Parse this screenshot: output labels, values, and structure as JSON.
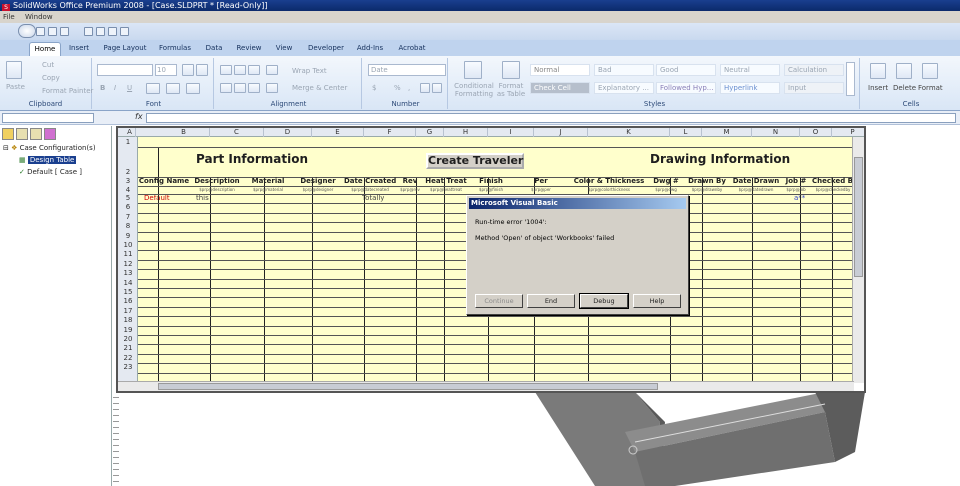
{
  "window": {
    "title": "SolidWorks Office Premium 2008 - [Case.SLDPRT * [Read-Only]]",
    "logo": "S"
  },
  "menu": [
    "File",
    "Window"
  ],
  "ribbon": {
    "tabs": [
      "Home",
      "Insert",
      "Page Layout",
      "Formulas",
      "Data",
      "Review",
      "View",
      "Developer",
      "Add-Ins",
      "Acrobat"
    ],
    "clipboard": {
      "paste": "Paste",
      "cut": "Cut",
      "copy": "Copy",
      "format_painter": "Format Painter",
      "label": "Clipboard"
    },
    "font": {
      "size": "10",
      "bold": "B",
      "italic": "I",
      "underline": "U",
      "label": "Font"
    },
    "alignment": {
      "wrap": "Wrap Text",
      "merge": "Merge & Center",
      "label": "Alignment"
    },
    "number": {
      "format": "Date",
      "currency": "$",
      "percent": "%",
      "comma": ",",
      "label": "Number"
    },
    "styles": {
      "conditional": "Conditional Formatting",
      "format_table": "Format as Table",
      "label": "Styles",
      "items": [
        {
          "name": "Normal",
          "bg": "#ffffff",
          "fg": "#888888"
        },
        {
          "name": "Bad",
          "bg": "#f7fbff",
          "fg": "#9aa5b3"
        },
        {
          "name": "Good",
          "bg": "#f7fbff",
          "fg": "#9aa5b3"
        },
        {
          "name": "Neutral",
          "bg": "#f7fbff",
          "fg": "#9aa5b3"
        },
        {
          "name": "Calculation",
          "bg": "#eef2f7",
          "fg": "#9aa5b3"
        },
        {
          "name": "Check Cell",
          "bg": "#b6bfcc",
          "fg": "#ffffff"
        },
        {
          "name": "Explanatory ...",
          "bg": "#f7fbff",
          "fg": "#9aa5b3"
        },
        {
          "name": "Followed Hyp...",
          "bg": "#f7fbff",
          "fg": "#8a7fb8"
        },
        {
          "name": "Hyperlink",
          "bg": "#f7fbff",
          "fg": "#6a8fd0"
        },
        {
          "name": "Input",
          "bg": "#eef2f7",
          "fg": "#9aa5b3"
        }
      ]
    },
    "cells": {
      "insert": "Insert",
      "delete": "Delete",
      "format": "Format",
      "label": "Cells"
    }
  },
  "formula_bar": {
    "fx": "fx"
  },
  "feature_tree": {
    "root": "Case Configuration(s)",
    "items": [
      "Design Table",
      "Default [ Case ]"
    ]
  },
  "sheet": {
    "columns": [
      "A",
      "B",
      "C",
      "D",
      "E",
      "F",
      "G",
      "H",
      "I",
      "J",
      "K",
      "L",
      "M",
      "N",
      "O",
      "P"
    ],
    "rows": [
      "1",
      "2",
      "3",
      "4",
      "5",
      "6",
      "7",
      "8",
      "9",
      "10",
      "11",
      "12",
      "13",
      "14",
      "15",
      "16",
      "17",
      "18",
      "19",
      "20",
      "21",
      "22",
      "23"
    ],
    "part_info_title": "Part Information",
    "drawing_info_title": "Drawing Information",
    "create_button": "Create Traveler",
    "headers": [
      "Config Name",
      "Description",
      "Material",
      "Designer",
      "Date Created",
      "Rev",
      "Heat Treat",
      "Finish",
      "Per",
      "Color & Thickness",
      "Dwg #",
      "Drawn By",
      "Date Drawn",
      "Job #",
      "Checked By"
    ],
    "subheaders": [
      "",
      "$prp@description",
      "$prp@material",
      "$prp@designer",
      "$prp@datecreated",
      "$prp@rev",
      "$prp@heattreat",
      "$prp@finish",
      "$prp@per",
      "$prp@colorthickness",
      "$prp@dwg",
      "$prp@drawnby",
      "$prp@datedrawn",
      "$prp@job",
      "$prp@checkedby"
    ],
    "row4": {
      "config": "Default",
      "description": "this",
      "date_created": "Totally",
      "job": "a**"
    }
  },
  "dialog": {
    "title": "Microsoft Visual Basic",
    "line1": "Run-time error '1004':",
    "line2": "Method 'Open' of object 'Workbooks' failed",
    "buttons": [
      "Continue",
      "End",
      "Debug",
      "Help"
    ]
  }
}
